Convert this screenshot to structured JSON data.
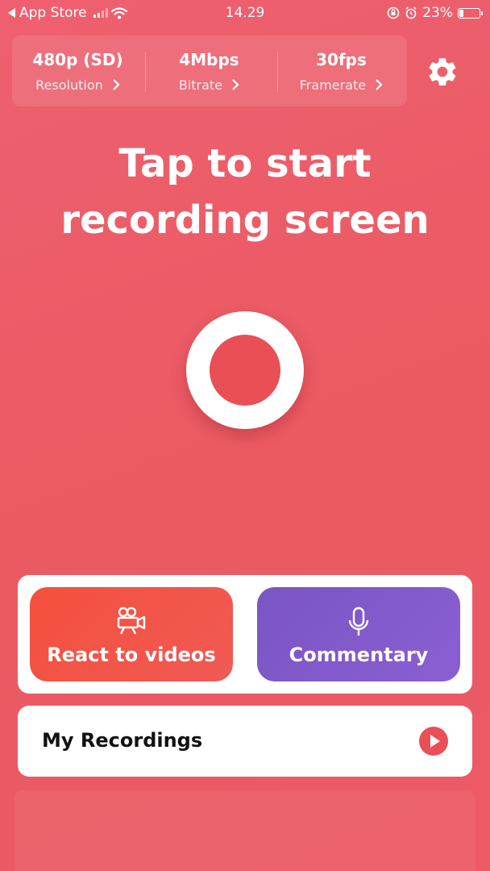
{
  "status_bar": {
    "back_label": "App Store",
    "time": "14.29",
    "battery": "23%",
    "battery_level": 0.23
  },
  "settings": [
    {
      "value": "480p (SD)",
      "label": "Resolution"
    },
    {
      "value": "4Mbps",
      "label": "Bitrate"
    },
    {
      "value": "30fps",
      "label": "Framerate"
    }
  ],
  "headline": {
    "line1": "Tap to start",
    "line2": "recording screen"
  },
  "cards": {
    "react_label": "React to videos",
    "commentary_label": "Commentary"
  },
  "my_recordings": {
    "label": "My Recordings"
  },
  "colors": {
    "accent": "#e94f55",
    "react": "#f4503c",
    "commentary": "#7a55c4"
  },
  "icons": [
    "back-arrow-icon",
    "signal-icon",
    "wifi-icon",
    "orientation-lock-icon",
    "alarm-icon",
    "battery-icon",
    "chevron-right-icon",
    "gear-icon",
    "movie-camera-icon",
    "microphone-icon",
    "play-icon"
  ]
}
